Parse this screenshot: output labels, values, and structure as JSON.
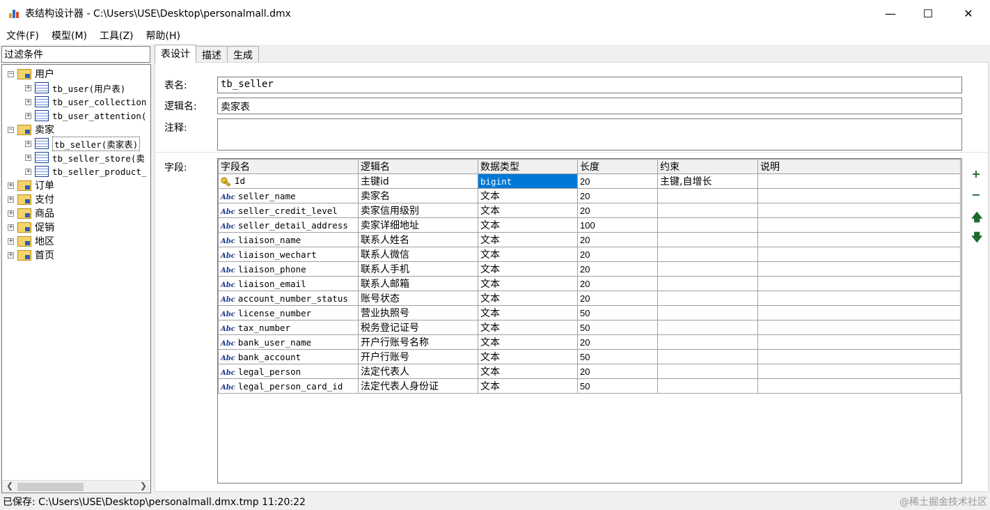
{
  "window": {
    "title": "表结构设计器 - C:\\Users\\USE\\Desktop\\personalmall.dmx"
  },
  "menu": [
    "文件(F)",
    "模型(M)",
    "工具(Z)",
    "帮助(H)"
  ],
  "filter_label": "过滤条件",
  "tree": [
    {
      "label": "用户",
      "type": "folder",
      "level": 0,
      "expanded": true
    },
    {
      "label": "tb_user(用户表)",
      "type": "table",
      "level": 1
    },
    {
      "label": "tb_user_collection",
      "type": "table",
      "level": 1
    },
    {
      "label": "tb_user_attention(",
      "type": "table",
      "level": 1
    },
    {
      "label": "卖家",
      "type": "folder",
      "level": 0,
      "expanded": true
    },
    {
      "label": "tb_seller(卖家表)",
      "type": "table",
      "level": 1,
      "selected": true
    },
    {
      "label": "tb_seller_store(卖",
      "type": "table",
      "level": 1
    },
    {
      "label": "tb_seller_product_",
      "type": "table",
      "level": 1
    },
    {
      "label": "订单",
      "type": "folder",
      "level": 0
    },
    {
      "label": "支付",
      "type": "folder",
      "level": 0
    },
    {
      "label": "商品",
      "type": "folder",
      "level": 0
    },
    {
      "label": "促销",
      "type": "folder",
      "level": 0
    },
    {
      "label": "地区",
      "type": "folder",
      "level": 0
    },
    {
      "label": "首页",
      "type": "folder",
      "level": 0
    }
  ],
  "tabs": [
    "表设计",
    "描述",
    "生成"
  ],
  "form": {
    "table_name_label": "表名:",
    "table_name": "tb_seller",
    "logical_name_label": "逻辑名:",
    "logical_name": "卖家表",
    "comment_label": "注释:",
    "comment": "",
    "fields_label": "字段:"
  },
  "grid": {
    "columns": [
      "字段名",
      "逻辑名",
      "数据类型",
      "长度",
      "约束",
      "说明"
    ],
    "rows": [
      [
        "Id",
        "主键id",
        "bigint",
        "20",
        "主键,自增长",
        ""
      ],
      [
        "seller_name",
        "卖家名",
        "文本",
        "20",
        "",
        ""
      ],
      [
        "seller_credit_level",
        "卖家信用级别",
        "文本",
        "20",
        "",
        ""
      ],
      [
        "seller_detail_address",
        "卖家详细地址",
        "文本",
        "100",
        "",
        ""
      ],
      [
        "liaison_name",
        "联系人姓名",
        "文本",
        "20",
        "",
        ""
      ],
      [
        "liaison_wechart",
        "联系人微信",
        "文本",
        "20",
        "",
        ""
      ],
      [
        "liaison_phone",
        "联系人手机",
        "文本",
        "20",
        "",
        ""
      ],
      [
        "liaison_email",
        "联系人邮箱",
        "文本",
        "20",
        "",
        ""
      ],
      [
        "account_number_status",
        "账号状态",
        "文本",
        "20",
        "",
        ""
      ],
      [
        "license_number",
        "营业执照号",
        "文本",
        "50",
        "",
        ""
      ],
      [
        "tax_number",
        "税务登记证号",
        "文本",
        "50",
        "",
        ""
      ],
      [
        "bank_user_name",
        "开户行账号名称",
        "文本",
        "20",
        "",
        ""
      ],
      [
        "bank_account",
        "开户行账号",
        "文本",
        "50",
        "",
        ""
      ],
      [
        "legal_person",
        "法定代表人",
        "文本",
        "20",
        "",
        ""
      ],
      [
        "legal_person_card_id",
        "法定代表人身份证",
        "文本",
        "50",
        "",
        ""
      ]
    ]
  },
  "side_buttons": [
    "+",
    "−",
    "↑",
    "↓"
  ],
  "status": "已保存: C:\\Users\\USE\\Desktop\\personalmall.dmx.tmp 11:20:22",
  "watermark": "@稀土掘金技术社区"
}
